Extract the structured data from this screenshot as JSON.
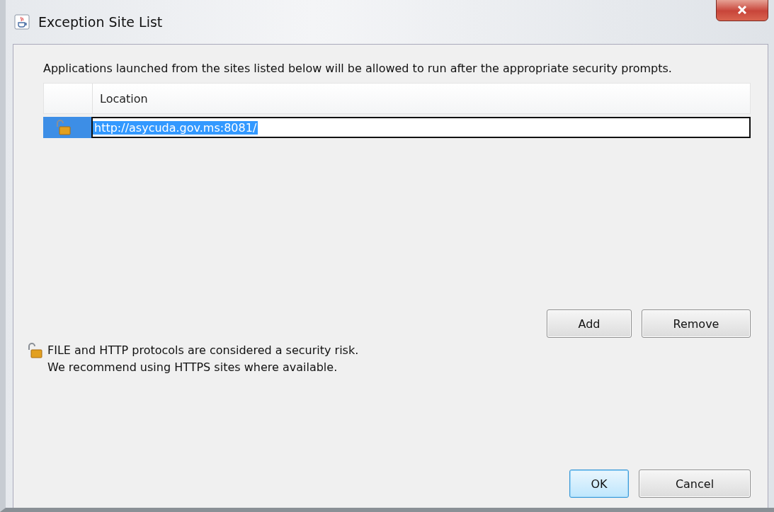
{
  "window": {
    "title": "Exception Site List"
  },
  "description": "Applications launched from the sites listed below will be allowed to run after the appropriate security prompts.",
  "table": {
    "columns": [
      "Location"
    ],
    "rows": [
      {
        "location": "http://asycuda.gov.ms:8081/",
        "selected": true
      }
    ]
  },
  "list_buttons": [
    "Add",
    "Remove"
  ],
  "warning": [
    "FILE and HTTP protocols are considered a security risk.",
    "We recommend using HTTPS sites where available."
  ],
  "dialog_buttons": [
    {
      "label": "OK",
      "default": true
    },
    {
      "label": "Cancel",
      "default": false
    }
  ]
}
